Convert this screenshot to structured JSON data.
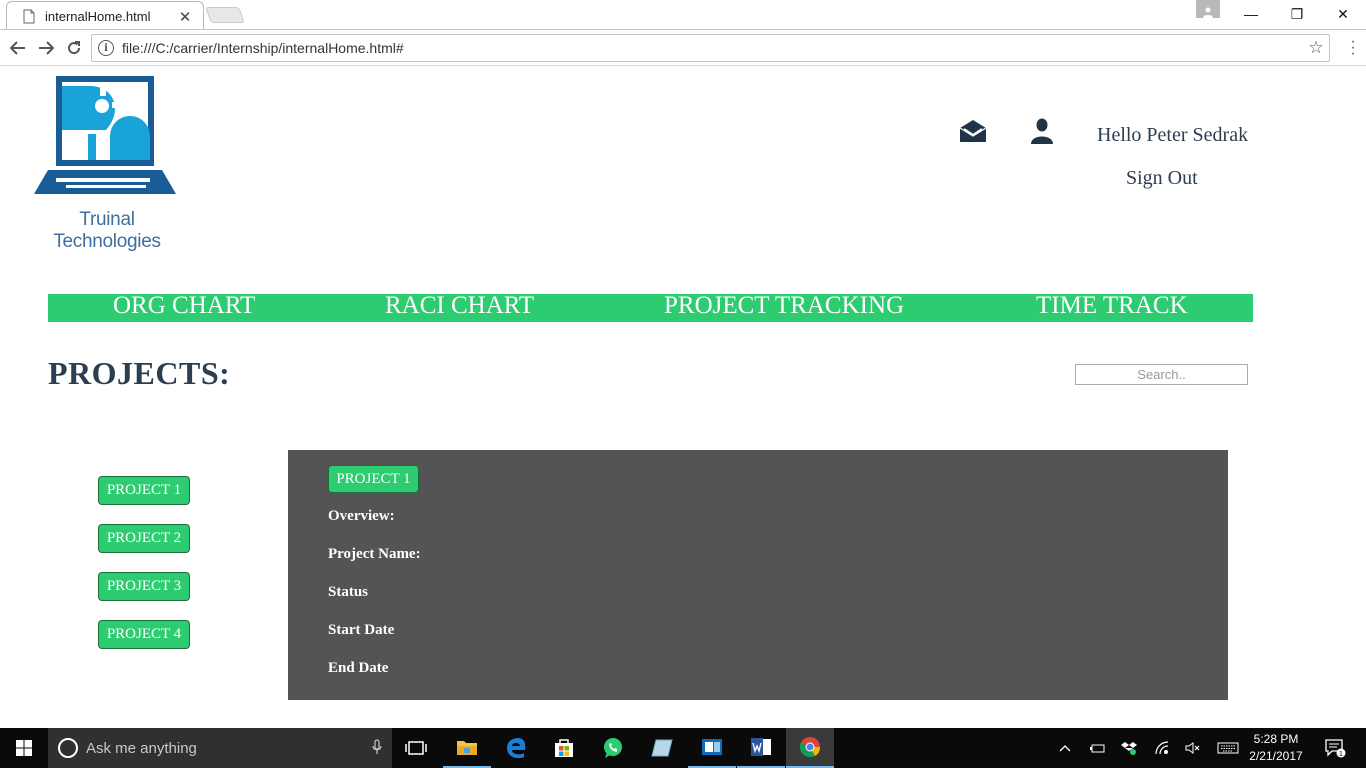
{
  "browser": {
    "tab_title": "internalHome.html",
    "tab_close": "✕",
    "url": "file:///C:/carrier/Internship/internalHome.html#",
    "window_controls": {
      "minimize": "—",
      "restore": "❐",
      "close": "✕"
    }
  },
  "header": {
    "logo_text": "Truinal Technologies",
    "greeting": "Hello Peter Sedrak",
    "sign_out": "Sign Out"
  },
  "nav": {
    "items": [
      "ORG CHART",
      "RACI CHART",
      "PROJECT TRACKING",
      "TIME TRACK"
    ]
  },
  "projects": {
    "heading": "PROJECTS:",
    "search_placeholder": "Search..",
    "list": [
      "PROJECT 1",
      "PROJECT 2",
      "PROJECT 3",
      "PROJECT 4"
    ]
  },
  "detail": {
    "selected": "PROJECT 1",
    "fields": [
      "Overview:",
      "Project Name:",
      "Status",
      "Start Date",
      "End Date"
    ]
  },
  "taskbar": {
    "search_text": "Ask me anything",
    "time": "5:28 PM",
    "date": "2/21/2017",
    "notification_count": "1"
  },
  "colors": {
    "accent_green": "#2ecc71",
    "heading_navy": "#2c3e50",
    "panel_gray": "#545454",
    "logo_blue": "#1a5c96"
  }
}
